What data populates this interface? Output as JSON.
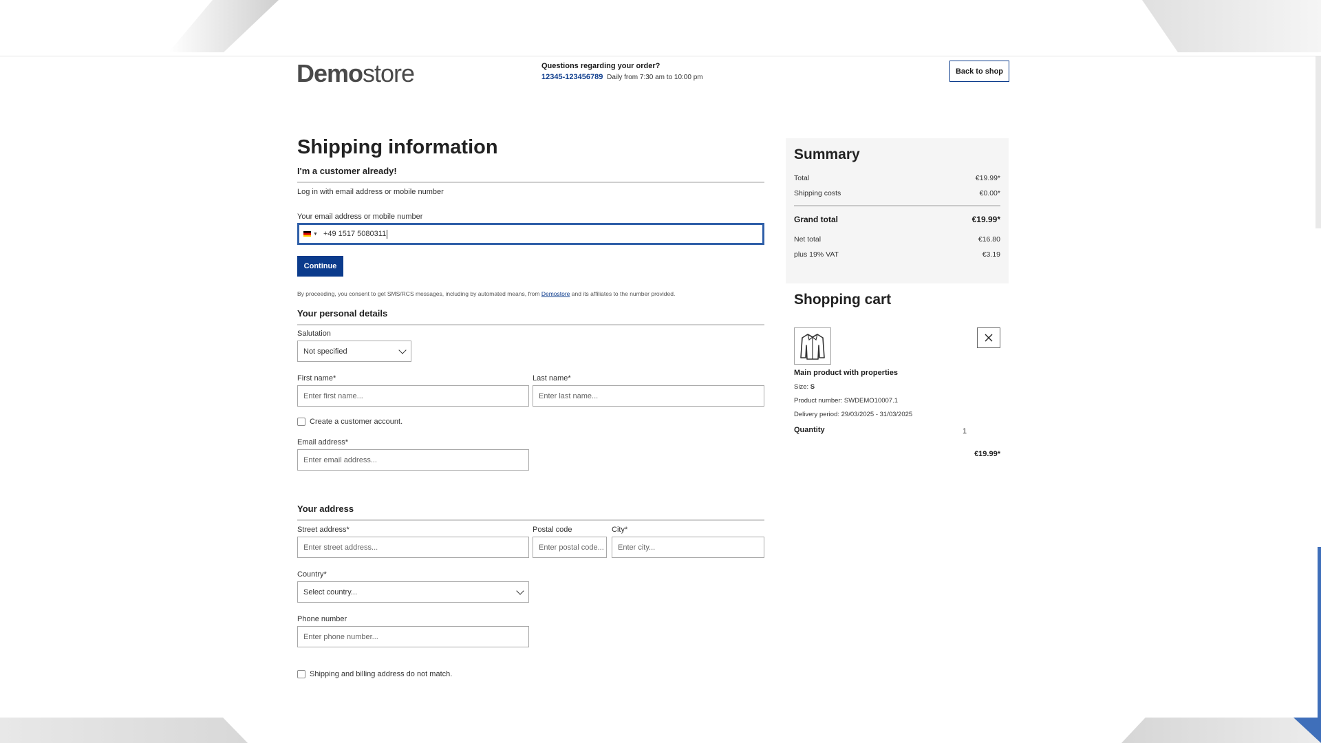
{
  "header": {
    "logo_bold": "Demo",
    "logo_light": "store",
    "help_question": "Questions regarding your order?",
    "help_phone": "12345-123456789",
    "help_hours": "Daily from 7:30 am to 10:00 pm",
    "back_button": "Back to shop"
  },
  "main": {
    "title": "Shipping information",
    "login": {
      "section_title": "I'm a customer already!",
      "subtitle": "Log in with email address or mobile number",
      "field_label": "Your email address or mobile number",
      "field_value": "+49 1517 5080311",
      "flag_icon": "germany-flag-icon",
      "continue_button": "Continue",
      "consent_before": "By proceeding, you consent to get SMS/RCS messages, including by automated means, from ",
      "consent_link": "Demostore",
      "consent_after": " and its affiliates to the number provided."
    },
    "personal": {
      "section_title": "Your personal details",
      "salutation_label": "Salutation",
      "salutation_value": "Not specified",
      "first_name_label": "First name*",
      "first_name_placeholder": "Enter first name...",
      "last_name_label": "Last name*",
      "last_name_placeholder": "Enter last name...",
      "create_account_label": "Create a customer account.",
      "create_account_checked": false,
      "email_label": "Email address*",
      "email_placeholder": "Enter email address..."
    },
    "address": {
      "section_title": "Your address",
      "street_label": "Street address*",
      "street_placeholder": "Enter street address...",
      "postal_label": "Postal code",
      "postal_placeholder": "Enter postal code...",
      "city_label": "City*",
      "city_placeholder": "Enter city...",
      "country_label": "Country*",
      "country_value": "Select country...",
      "phone_label": "Phone number",
      "phone_placeholder": "Enter phone number...",
      "different_billing_label": "Shipping and billing address do not match.",
      "different_billing_checked": false
    }
  },
  "summary": {
    "title": "Summary",
    "rows": [
      {
        "label": "Total",
        "value": "€19.99*"
      },
      {
        "label": "Shipping costs",
        "value": "€0.00*"
      }
    ],
    "grand_total": {
      "label": "Grand total",
      "value": "€19.99*"
    },
    "tax_rows": [
      {
        "label": "Net total",
        "value": "€16.80"
      },
      {
        "label": "plus 19% VAT",
        "value": "€3.19"
      }
    ]
  },
  "cart": {
    "title": "Shopping cart",
    "item": {
      "image_icon": "jacket-icon",
      "name": "Main product with properties",
      "size_label": "Size:",
      "size_value": "S",
      "product_number": "Product number: SWDEMO10007.1",
      "delivery": "Delivery period: 29/03/2025 - 31/03/2025",
      "quantity_label": "Quantity",
      "quantity_value": "1",
      "price": "€19.99*"
    }
  },
  "colors": {
    "primary": "#0b3b8c",
    "focus_border": "#2f5fa8",
    "summary_bg": "#f5f5f5"
  }
}
